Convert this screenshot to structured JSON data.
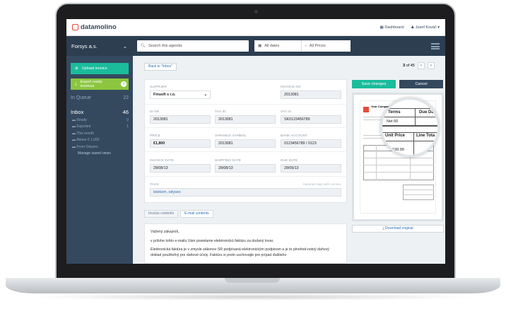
{
  "app": {
    "logo": "datamolino"
  },
  "topbar": {
    "dashboard": "Dashboard",
    "user": "Jozef Kováč"
  },
  "nav": {
    "company": "Forsys a.s.",
    "search_placeholder": "Search this agenda",
    "dates": "All dates",
    "prices": "All Prices"
  },
  "sidebar": {
    "upload": "Upload invoice",
    "export": "Export ready invoices",
    "export_count": "4",
    "queue": {
      "label": "In Queue",
      "count": "22"
    },
    "inbox": {
      "label": "Inbox",
      "count": "46"
    },
    "items": [
      {
        "label": "Ready",
        "count": "0"
      },
      {
        "label": "Exported",
        "count": "1"
      },
      {
        "label": "This month",
        "count": ""
      },
      {
        "label": "Above € 1,000",
        "count": ""
      },
      {
        "label": "From Odyseo",
        "count": ""
      }
    ],
    "manage": "Manage saved views"
  },
  "toolbar": {
    "back": "Back to \"Inbox\"",
    "pager_prefix": "3",
    "pager_suffix": "of 45",
    "prev": "‹",
    "next": "›"
  },
  "form": {
    "supplier": {
      "label": "Supplier",
      "value": "Finsoft s r.o."
    },
    "invoice_no": {
      "label": "Invoice No",
      "value": "2013081"
    },
    "id_nr": {
      "label": "ID Nr",
      "value": "2013081"
    },
    "tax_id": {
      "label": "Tax ID",
      "value": "2013081"
    },
    "vat_id": {
      "label": "VAT ID",
      "value": "SK0123456789"
    },
    "price": {
      "label": "Price",
      "value": "€1,800"
    },
    "variable_symbol": {
      "label": "Variable symbol",
      "value": "2013081"
    },
    "bank_account": {
      "label": "Bank account",
      "value": "0123456789 / 0123"
    },
    "invoice_date": {
      "label": "Invoice date",
      "value": "28/08/13"
    },
    "shipping_date": {
      "label": "Shipping date",
      "value": "28/08/13"
    },
    "due_date": {
      "label": "Due date",
      "value": "28/09/13"
    },
    "tags": {
      "label": "Tags",
      "value": "telekom, odyseo",
      "hint": "Separate tags with comma"
    }
  },
  "tabs": [
    {
      "label": "Invoice contents"
    },
    {
      "label": "E-mail contents"
    }
  ],
  "email": {
    "greeting": "Vážený zákazník,",
    "p1": "v prílohe tohto e-mailu Vám posielame elektronickú faktúru za dodaný tovar.",
    "p2": "Elektronická faktúra je v zmysle zákonov SR podpísaná elektronickým podpisom a je to plnohod-notný daňový doklad použiteľný pre daňové účely. Faktúru si preto uschovajte pre prípad ďalšieho"
  },
  "actions": {
    "save": "Save changes",
    "cancel": "Cancel",
    "download": "Download original"
  },
  "preview": {
    "company": "Your Company",
    "terms": "Terms",
    "due": "Due Da",
    "net": "Net 60",
    "unit_price": "Unit Price",
    "line_total": "Line Tota",
    "unit_value": "199.99"
  },
  "colors": {
    "teal": "#1abc9c",
    "green": "#8cc63f",
    "navy": "#2c3e50",
    "sidebar": "#34495e",
    "logo_red": "#e74c3c"
  }
}
